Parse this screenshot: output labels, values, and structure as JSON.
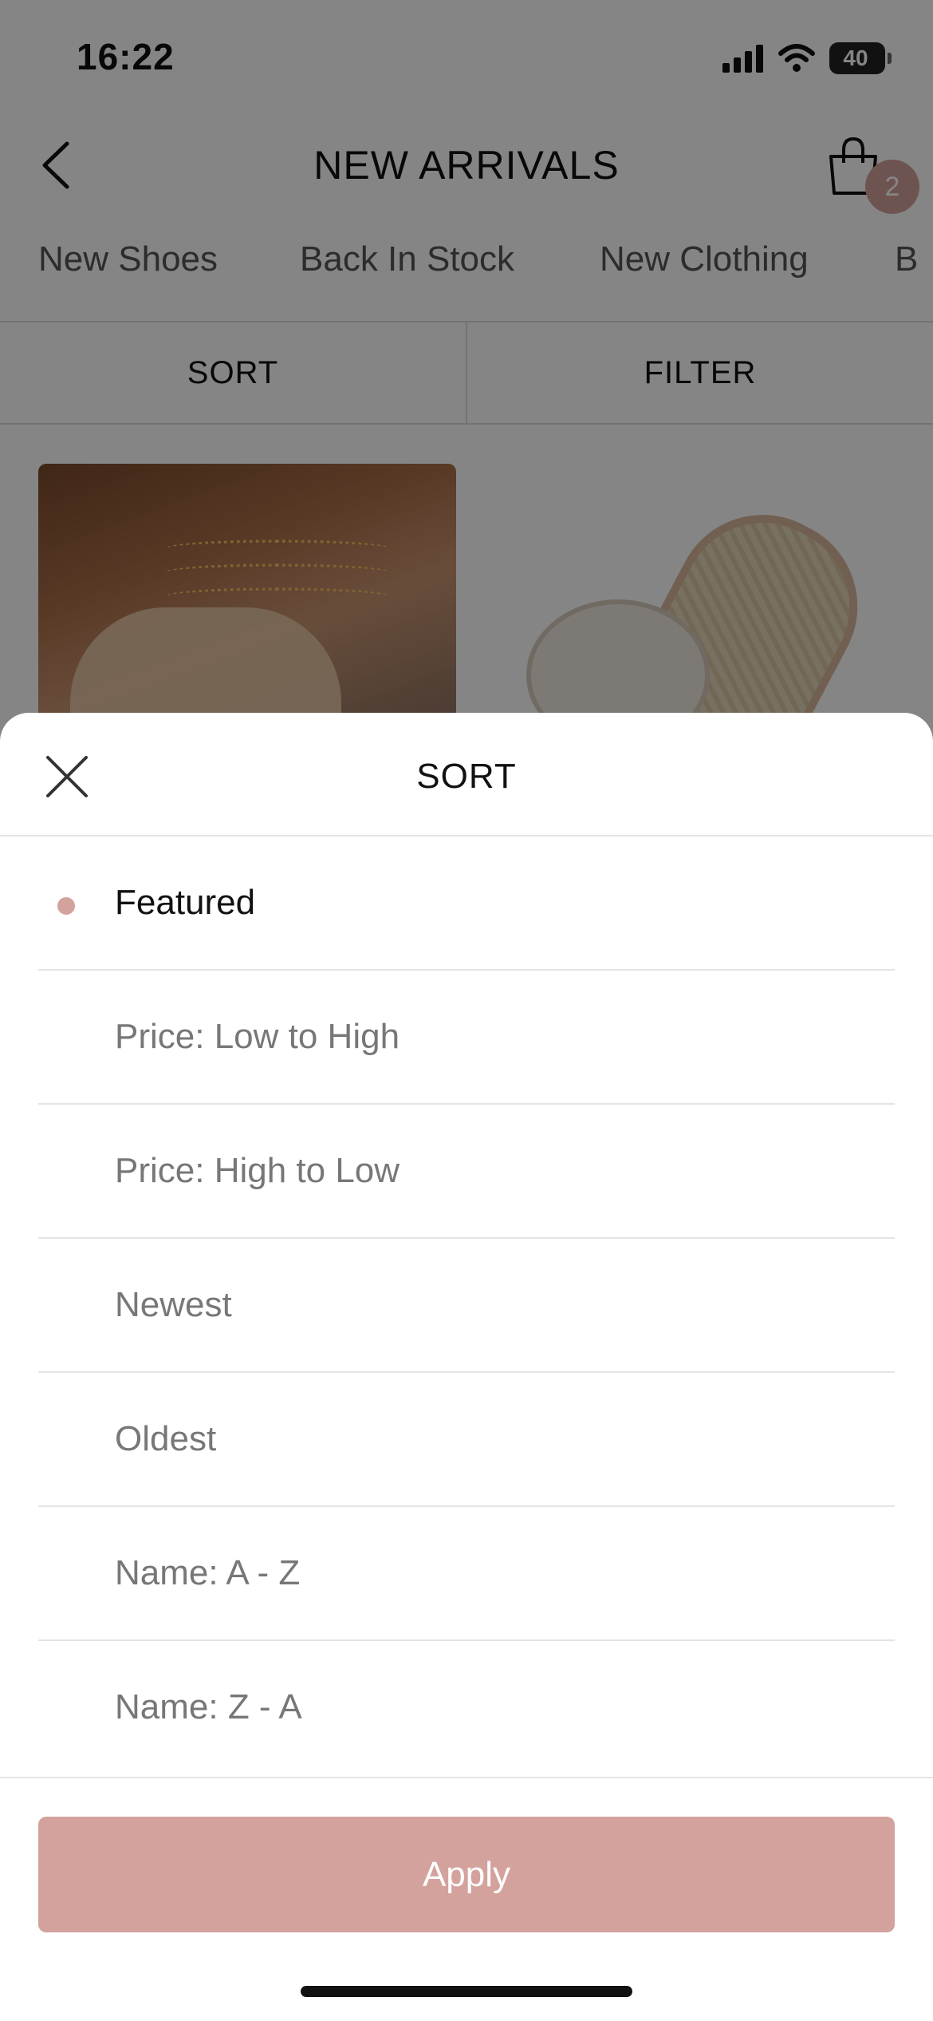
{
  "status_bar": {
    "time": "16:22",
    "battery": "40"
  },
  "nav": {
    "title": "NEW ARRIVALS",
    "cart_count": "2"
  },
  "category_tabs": [
    "New Shoes",
    "Back In Stock",
    "New Clothing",
    "B"
  ],
  "toolbar": {
    "sort_label": "SORT",
    "filter_label": "FILTER"
  },
  "sort_sheet": {
    "title": "SORT",
    "options": [
      {
        "label": "Featured",
        "selected": true
      },
      {
        "label": "Price: Low to High",
        "selected": false
      },
      {
        "label": "Price: High to Low",
        "selected": false
      },
      {
        "label": "Newest",
        "selected": false
      },
      {
        "label": "Oldest",
        "selected": false
      },
      {
        "label": "Name: A - Z",
        "selected": false
      },
      {
        "label": "Name: Z - A",
        "selected": false
      }
    ],
    "apply_label": "Apply"
  },
  "colors": {
    "accent": "#d4a29c",
    "overlay": "rgba(0,0,0,0.48)"
  },
  "icons": {
    "back": "chevron-left-icon",
    "cart": "shopping-bag-icon",
    "close": "close-icon"
  }
}
